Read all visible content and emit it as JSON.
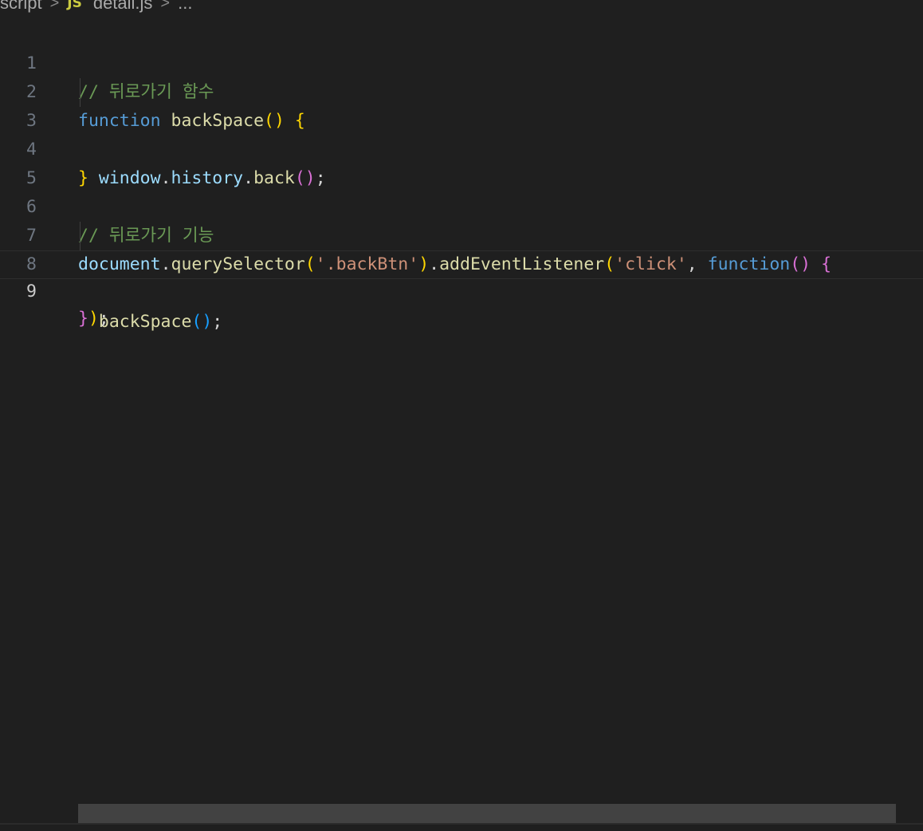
{
  "breadcrumb": {
    "folder": "script",
    "file_icon": "JS",
    "file": "detail.js",
    "more": "...",
    "separator": ">"
  },
  "editor": {
    "current_line": 9,
    "lines": [
      {
        "number": "1"
      },
      {
        "number": "2"
      },
      {
        "number": "3"
      },
      {
        "number": "4"
      },
      {
        "number": "5"
      },
      {
        "number": "6"
      },
      {
        "number": "7"
      },
      {
        "number": "8"
      },
      {
        "number": "9"
      }
    ],
    "tokens": {
      "l1_comment": "// 뒤로가기 함수",
      "l2_kw": "function",
      "l2_fn": "backSpace",
      "l2_paren": "()",
      "l2_brace": "{",
      "l3_window": "window",
      "l3_history": "history",
      "l3_back": "back",
      "l3_paren": "()",
      "l3_semi": ";",
      "l4_brace": "}",
      "l6_comment": "// 뒤로가기 기능",
      "l7_document": "document",
      "l7_qs": "querySelector",
      "l7_str1": "'.backBtn'",
      "l7_ael": "addEventListener",
      "l7_str2": "'click'",
      "l7_kw": "function",
      "l7_paren": "()",
      "l7_brace": "{",
      "l8_fn": "backSpace",
      "l8_paren": "()",
      "l8_semi": ";",
      "l9_brace": "}",
      "l9_paren": ")",
      "l9_semi": ";"
    }
  },
  "colors": {
    "background": "#1f1f1f",
    "comment": "#6a9955",
    "keyword": "#569cd6",
    "function": "#dcdcaa",
    "variable": "#9cdcfe",
    "string": "#ce9178",
    "bracket_level1": "#ffd700",
    "bracket_level2": "#da70d6",
    "bracket_level3": "#179fff"
  }
}
